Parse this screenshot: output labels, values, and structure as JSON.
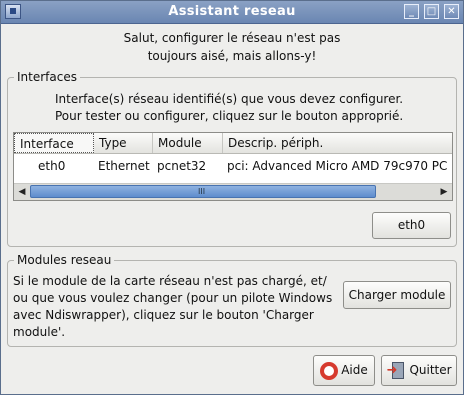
{
  "window": {
    "title": "Assistant reseau",
    "controls": {
      "minimize": "_",
      "maximize": "□",
      "close": "✕"
    }
  },
  "intro": {
    "line1": "Salut, configurer le réseau n'est pas",
    "line2": "toujours aisé, mais allons-y!"
  },
  "interfaces": {
    "label": "Interfaces",
    "desc_line1": "Interface(s) réseau identifié(s) que vous devez configurer.",
    "desc_line2": "Pour tester ou configurer, cliquez sur le bouton approprié.",
    "columns": [
      "Interface",
      "Type",
      "Module",
      "Descrip. périph."
    ],
    "rows": [
      {
        "interface": "eth0",
        "type": "Ethernet",
        "module": "pcnet32",
        "description": "pci:  Advanced Micro AMD 79c970 PC"
      }
    ],
    "scroll_left": "◀",
    "scroll_right": "▶",
    "scroll_grip": "III",
    "button_eth0": "eth0"
  },
  "modules": {
    "label": "Modules reseau",
    "desc_line1": "Si le module de la carte réseau n'est pas chargé, et/",
    "desc_line2": "ou que vous voulez changer (pour un pilote Windows",
    "desc_line3": "avec Ndiswrapper), cliquez sur le bouton 'Charger",
    "desc_line4": "module'.",
    "button_load": "Charger module"
  },
  "footer": {
    "help_label": "Aide",
    "help_icon": "lifebuoy-icon",
    "quit_label": "Quitter",
    "quit_icon": "exit-icon"
  }
}
